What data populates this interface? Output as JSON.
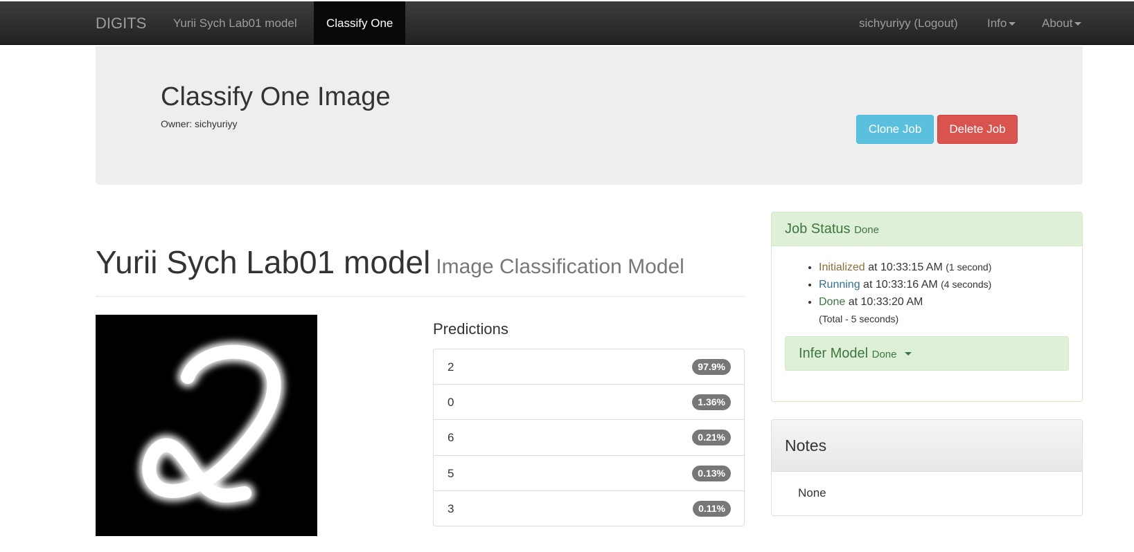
{
  "navbar": {
    "brand": "DIGITS",
    "model_link": "Yurii Sych Lab01 model",
    "active_link": "Classify One",
    "user_link": "sichyuriyy (Logout)",
    "info_menu": "Info",
    "about_menu": "About"
  },
  "header": {
    "title": "Classify One Image",
    "owner": "Owner: sichyuriyy",
    "clone_button": "Clone Job",
    "delete_button": "Delete Job"
  },
  "model": {
    "name": "Yurii Sych Lab01 model",
    "type": "Image Classification Model"
  },
  "input_image": {
    "alt": "handwritten digit 2"
  },
  "predictions": {
    "title": "Predictions",
    "items": [
      {
        "label": "2",
        "value": "97.9%"
      },
      {
        "label": "0",
        "value": "1.36%"
      },
      {
        "label": "6",
        "value": "0.21%"
      },
      {
        "label": "5",
        "value": "0.13%"
      },
      {
        "label": "3",
        "value": "0.11%"
      }
    ]
  },
  "job_status": {
    "title": "Job Status",
    "state": "Done",
    "steps": [
      {
        "name": "Initialized",
        "at": " at 10:33:15 AM ",
        "duration": "(1 second)"
      },
      {
        "name": "Running",
        "at": " at 10:33:16 AM ",
        "duration": "(4 seconds)"
      },
      {
        "name": "Done",
        "at": " at 10:33:20 AM",
        "duration": ""
      }
    ],
    "total": "(Total - 5 seconds)",
    "infer": {
      "label": "Infer Model",
      "state": "Done"
    }
  },
  "notes": {
    "title": "Notes",
    "body": "None"
  },
  "colors": {
    "navbar_bg": "#222222",
    "info_button": "#5bc0de",
    "danger_button": "#d9534f",
    "success_bg": "#dff0d8",
    "badge_bg": "#777777"
  }
}
